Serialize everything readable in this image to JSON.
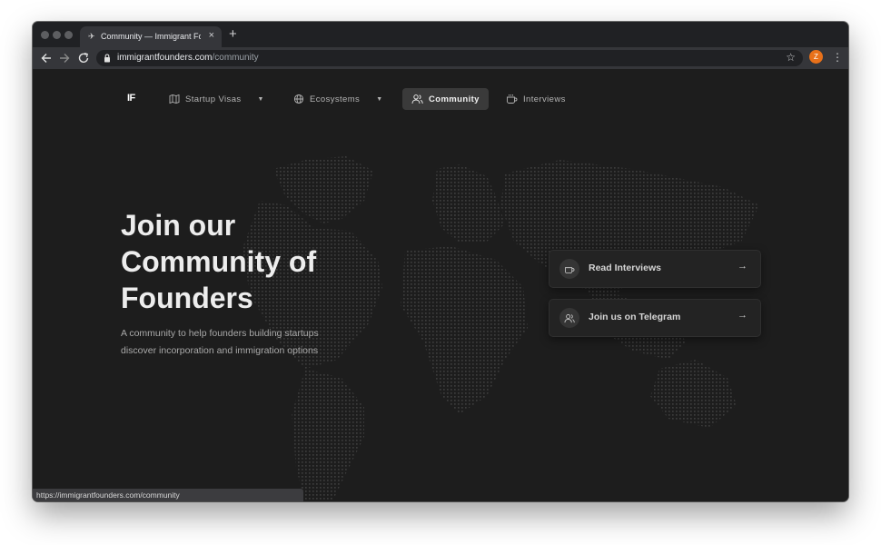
{
  "browser": {
    "tab_title": "Community — Immigrant Founders",
    "close_glyph": "×",
    "newtab_glyph": "+",
    "url_domain": "immigrantfounders.com",
    "url_path": "/community",
    "star_glyph": "☆",
    "profile_initial": "Z",
    "profile_color": "#e8711a",
    "menu_glyph": "⋮",
    "status_url": "https://immigrantfounders.com/community"
  },
  "site": {
    "logo": "IF",
    "nav": {
      "startup_visas": "Startup Visas",
      "ecosystems": "Ecosystems",
      "community": "Community",
      "interviews": "Interviews",
      "caret": "▼"
    },
    "hero": {
      "title_line1": "Join our",
      "title_line2": "Community of",
      "title_line3": "Founders",
      "subtitle_line1": "A community to help founders building startups",
      "subtitle_line2": "discover incorporation and immigration options"
    },
    "cards": {
      "read_interviews": "Read Interviews",
      "join_telegram": "Join us on Telegram",
      "arrow": "→"
    }
  },
  "colors": {
    "background": "#1d1d1d",
    "chrome_dark": "#202124",
    "chrome_toolbar": "#35363a",
    "nav_active": "#3a3a3a"
  }
}
